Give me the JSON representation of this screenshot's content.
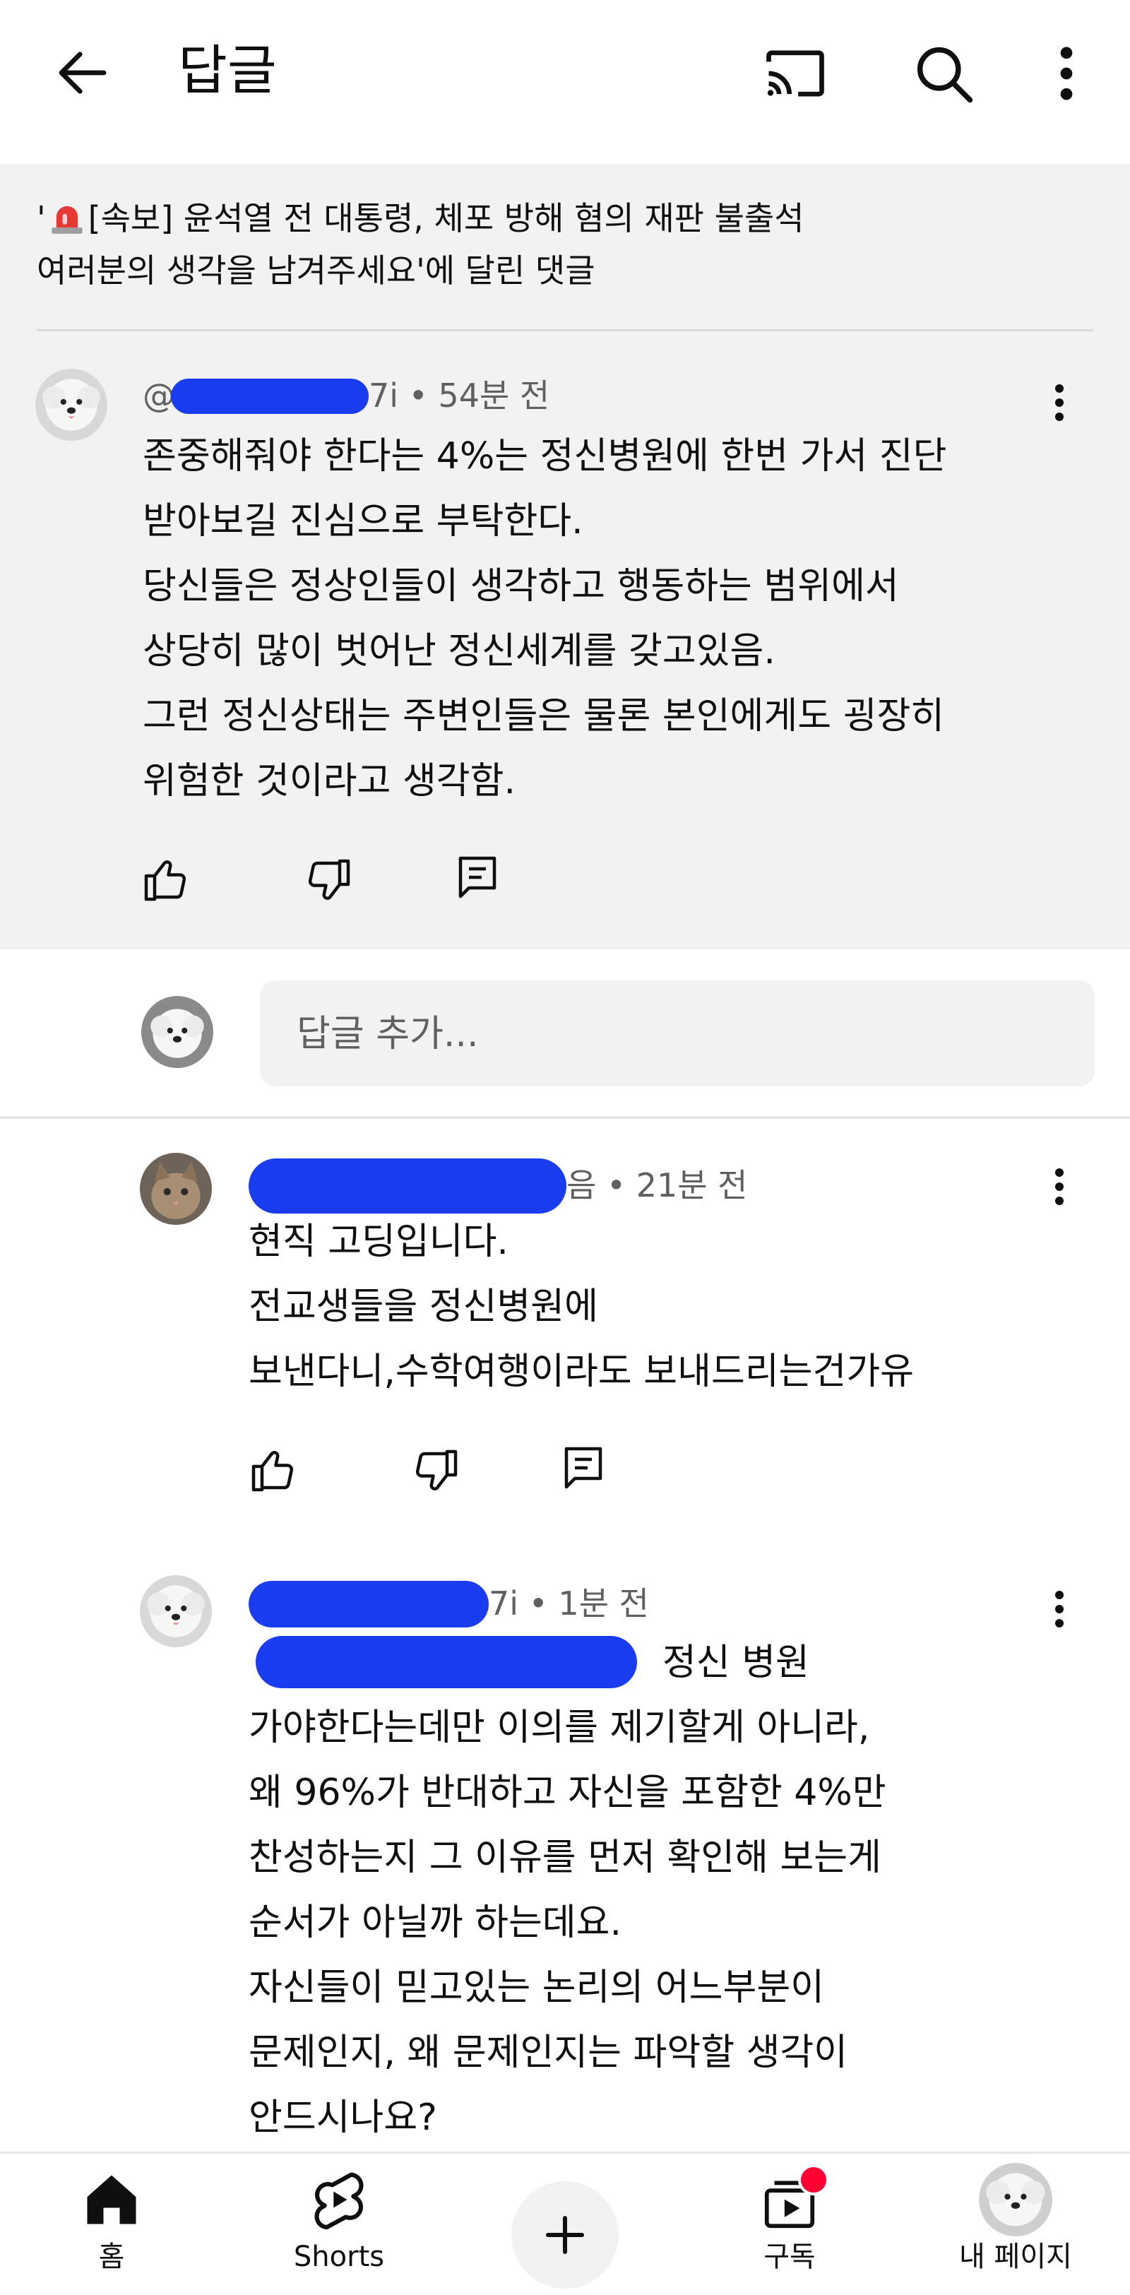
{
  "header": {
    "title": "답글"
  },
  "context": {
    "prefix": "'",
    "tag": "[속보] 윤석열 전 대통령, 체포 방해 혐의 재판 불출석",
    "line2": "여러분의 생각을 남겨주세요'에 달린 댓글"
  },
  "parent_comment": {
    "handle_tail": "7i",
    "time": " • 54분 전",
    "text": "존중해줘야 한다는 4%는 정신병원에 한번 가서 진단\n받아보길 진심으로 부탁한다.\n당신들은 정상인들이 생각하고 행동하는 범위에서\n상당히 많이 벗어난 정신세계를 갖고있음.\n그런 정신상태는 주변인들은 물론 본인에게도 굉장히\n위험한 것이라고 생각함."
  },
  "reply_input": {
    "placeholder": "답글 추가..."
  },
  "replies": [
    {
      "handle_tail": "음",
      "time": " • 21분 전",
      "text": "현직 고딩입니다.\n전교생들을 정신병원에\n보낸다니,수학여행이라도 보내드리는건가유"
    },
    {
      "handle_tail": "7i",
      "time": " • 1분 전",
      "mention_tail": "정신 병원",
      "text": "가야한다는데만 이의를 제기할게 아니라,\n왜 96%가 반대하고 자신을 포함한 4%만\n찬성하는지 그 이유를 먼저 확인해 보는게\n순서가 아닐까 하는데요.\n자신들이 믿고있는 논리의 어느부분이\n문제인지, 왜 문제인지는 파악할 생각이\n안드시나요?"
    }
  ],
  "bottom_nav": {
    "home": "홈",
    "shorts": "Shorts",
    "subscriptions": "구독",
    "my_page": "내 페이지"
  },
  "colors": {
    "redaction": "#1a3cf0",
    "notification": "#ff0033",
    "background_band": "#f2f2f2"
  }
}
